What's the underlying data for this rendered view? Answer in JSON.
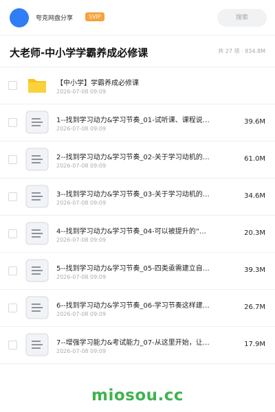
{
  "header": {
    "share_name": "夸克网盘分享",
    "badge": "SVIP",
    "search_placeholder": "搜索",
    "avatar_color": "#2f7ef5",
    "badge_color": "#f7a23b"
  },
  "title_row": {
    "title": "大老师-中小学学霸养成必修课",
    "summary": "共 27 项 · 834.8M"
  },
  "files": [
    {
      "type": "folder-icon",
      "name": "【中小学】学霸养成必修课",
      "date": "2026-07-08 09:09",
      "size": ""
    },
    {
      "type": "document-icon",
      "name": "1--找到学习动力&学习节奏_01-试听课、课程说…",
      "date": "2026-07-08 09:09",
      "size": "39.6M"
    },
    {
      "type": "document-icon",
      "name": "2--找到学习动力&学习节奏_02-关于学习动机的…",
      "date": "2026-07-08 09:09",
      "size": "61.0M"
    },
    {
      "type": "document-icon",
      "name": "3--找到学习动力&学习节奏_03-关于学习动机的…",
      "date": "2026-07-08 09:09",
      "size": "34.6M"
    },
    {
      "type": "document-icon",
      "name": "4--找到学习动力&学习节奏_04-可以被提升的“…",
      "date": "2026-07-08 09:09",
      "size": "20.3M"
    },
    {
      "type": "document-icon",
      "name": "5--找到学习动力&学习节奏_05-四类亟需建立自…",
      "date": "2026-07-08 09:09",
      "size": "39.3M"
    },
    {
      "type": "document-icon",
      "name": "6--找到学习动力&学习节奏_06-学习节奏这样建…",
      "date": "2026-07-08 09:09",
      "size": "26.7M"
    },
    {
      "type": "document-icon",
      "name": "7--增强学习能力&考试能力_07-从这里开始，让…",
      "date": "2026-07-08 09:09",
      "size": "17.9M"
    }
  ],
  "watermark": "miosou.cc",
  "colors": {
    "folder": "#f8c517",
    "watermark": "#3fb34f"
  }
}
